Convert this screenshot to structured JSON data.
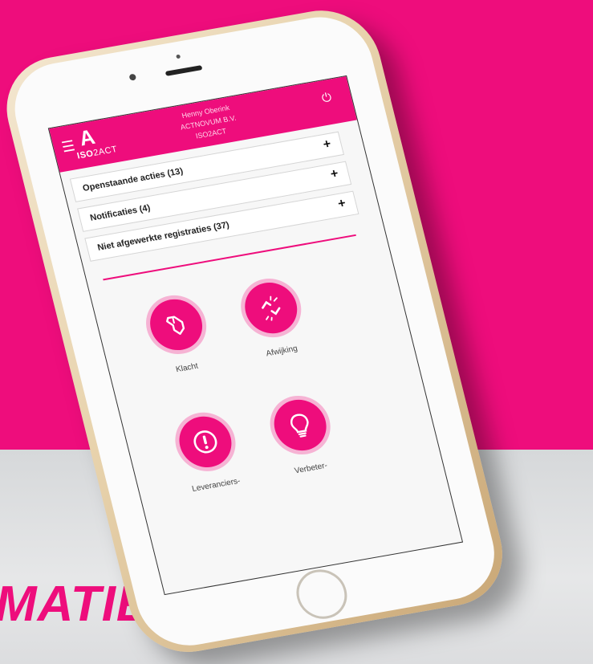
{
  "colors": {
    "accent": "#ee0d7c"
  },
  "header": {
    "menu_icon": "hamburger-icon",
    "logo_mark": "A",
    "logo_iso": "ISO",
    "logo_rest": "2ACT",
    "user_name": "Henny Oberink",
    "company": "ACTNOVUM B.V.",
    "product": "ISO2ACT",
    "power_icon": "power-icon"
  },
  "sections": [
    {
      "label": "Openstaande acties (13)",
      "toggle": "+"
    },
    {
      "label": "Notificaties (4)",
      "toggle": "+"
    },
    {
      "label": "Niet afgewerkte registraties (37)",
      "toggle": "+"
    }
  ],
  "tiles": [
    {
      "label": "Klacht",
      "icon": "pointing-hand-icon"
    },
    {
      "label": "Afwijking",
      "icon": "broken-link-icon"
    },
    {
      "label": "Leveranciers-",
      "icon": "alert-icon"
    },
    {
      "label": "Verbeter-",
      "icon": "lightbulb-icon"
    }
  ],
  "banner_text": "MATIE"
}
